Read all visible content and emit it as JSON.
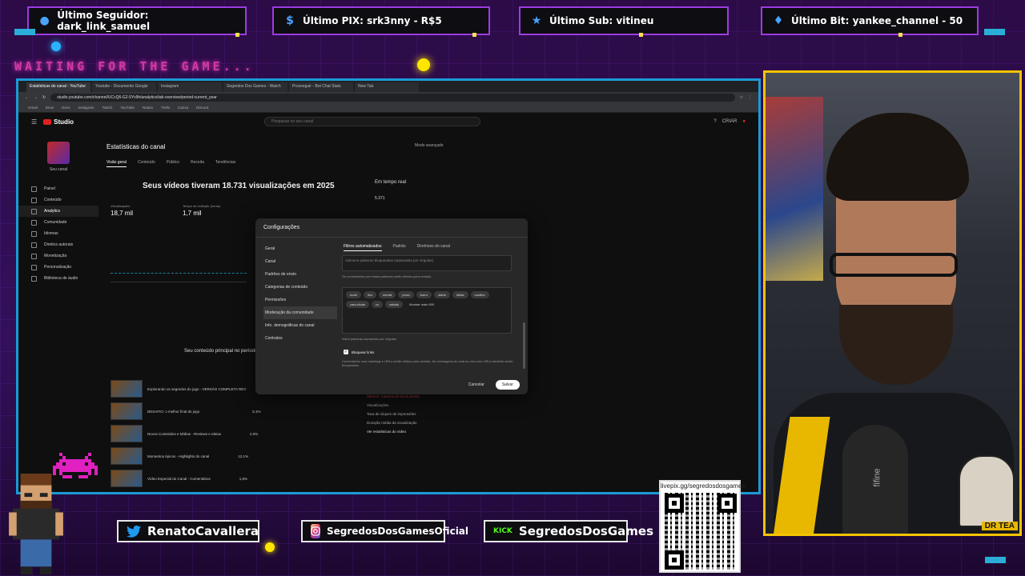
{
  "alerts": [
    {
      "label": "Último Seguidor: dark_link_samuel",
      "icon": "user-icon"
    },
    {
      "label": "Último PIX: srk3nny - R$5",
      "icon": "dollar-icon"
    },
    {
      "label": "Último Sub: vitineu",
      "icon": "star-icon"
    },
    {
      "label": "Último Bit: yankee_channel - 50",
      "icon": "diamond-icon"
    }
  ],
  "waiting_text": "WAITING FOR THE GAME...",
  "browser": {
    "tabs": [
      "Estatísticas do canal - YouTube",
      "Youtube - Documento Google",
      "Instagram",
      "Segredos Dos Games - Watch",
      "Prosseguir - Bot Chat Stats",
      "New Tab"
    ],
    "url": "studio.youtube.com/channel/UCcQ6-G2-5Yv9h/analytics/tab-overview/period-current_year",
    "bookmarks": [
      "Gmail",
      "Drive",
      "Docs",
      "Instagram",
      "Twitch",
      "YouTube",
      "Notion",
      "Trello",
      "Canva",
      "Discord"
    ]
  },
  "studio": {
    "logo": "Studio",
    "search_placeholder": "Pesquisar no seu canal",
    "header_right": [
      "CRIAR"
    ],
    "channel_name": "Seu canal",
    "sidebar": [
      "Painel",
      "Conteúdo",
      "Analytics",
      "Comunidade",
      "Idiomas",
      "Direitos autorais",
      "Monetização",
      "Personalização",
      "Biblioteca de áudio"
    ],
    "title": "Estatísticas do canal",
    "tabs": [
      "Visão geral",
      "Conteúdo",
      "Público",
      "Receita",
      "Tendências"
    ],
    "advanced": "Modo avançado",
    "headline": "Seus vídeos tiveram 18.731 visualizações em 2025",
    "realtime_label": "Em tempo real",
    "realtime_value": "5.371",
    "metrics": [
      {
        "label": "Visualizações",
        "value": "18,7 mil"
      },
      {
        "label": "Tempo de exibição (horas)",
        "value": "1,7 mil"
      }
    ],
    "content_head": "Seu conteúdo principal no período",
    "videos": [
      {
        "title": "Explorando os segredos do jogo - VERSÃO COMPLETA REV",
        "views": "2.1%"
      },
      {
        "title": "DESAFIO: o melhor final do jogo",
        "views": "5.1%"
      },
      {
        "title": "Novos Conteúdos e Mídias - Reviews e Ideias",
        "views": "2.0%"
      },
      {
        "title": "Momentos épicos - Highlights do canal",
        "views": "12,1%"
      },
      {
        "title": "Vídeo Especial do Canal - Comentários",
        "views": "1,5%"
      }
    ],
    "right_panel": [
      "Últimos: Caverna de Ecos (teste)",
      "Visualizações",
      "Taxa de cliques de impressões",
      "Duração média da visualização",
      "Ver estatísticas do vídeo"
    ]
  },
  "dialog": {
    "title": "Configurações",
    "nav": [
      "Geral",
      "Canal",
      "Padrões de envio",
      "Categorias de conteúdo",
      "Permissões",
      "Moderação da comunidade",
      "Info. demográficas do canal",
      "Contratos"
    ],
    "tabs": [
      "Filtros automatizados",
      "Padrão",
      "Diretrizes do canal"
    ],
    "field_text": "Adicione palavras bloqueadas (separadas por vírgulas)",
    "help1": "Os comentários com estas palavras serão retidos para revisão.",
    "chips": [
      "noob",
      "lixo",
      "merda",
      "porra",
      "burro",
      "otário",
      "idiota",
      "caralho",
      "cara-chata",
      "cu",
      "safado"
    ],
    "more_chips": "Mostrar mais 900",
    "help2": "Insira palavras separadas por vírgulas",
    "checkbox_label": "Bloquear links",
    "help3": "Comentários com hashtags e URLs serão retidos para revisão. As mensagens do chat ao vivo com URLs também serão bloqueadas.",
    "cancel": "Cancelar",
    "save": "Salvar"
  },
  "socials": [
    {
      "label": "RenatoCavallera",
      "icon": "twitter-icon",
      "color": "#1d9bf0"
    },
    {
      "label": "SegredosDosGamesOficial",
      "icon": "instagram-icon",
      "color": "#c13584"
    },
    {
      "label": "SegredosDosGames",
      "icon": "kick-icon",
      "color": "#53fc18"
    }
  ],
  "kick_text": "KICK",
  "qr_url": "livepix.gg/segredosdosgames",
  "webcam": {
    "mic_brand": "fifine",
    "shirt_text": "DR TEA"
  },
  "colors": {
    "frame": "#1a9bd7",
    "webcam_border": "#f5c400",
    "alert_border": "#9d3ce0"
  }
}
